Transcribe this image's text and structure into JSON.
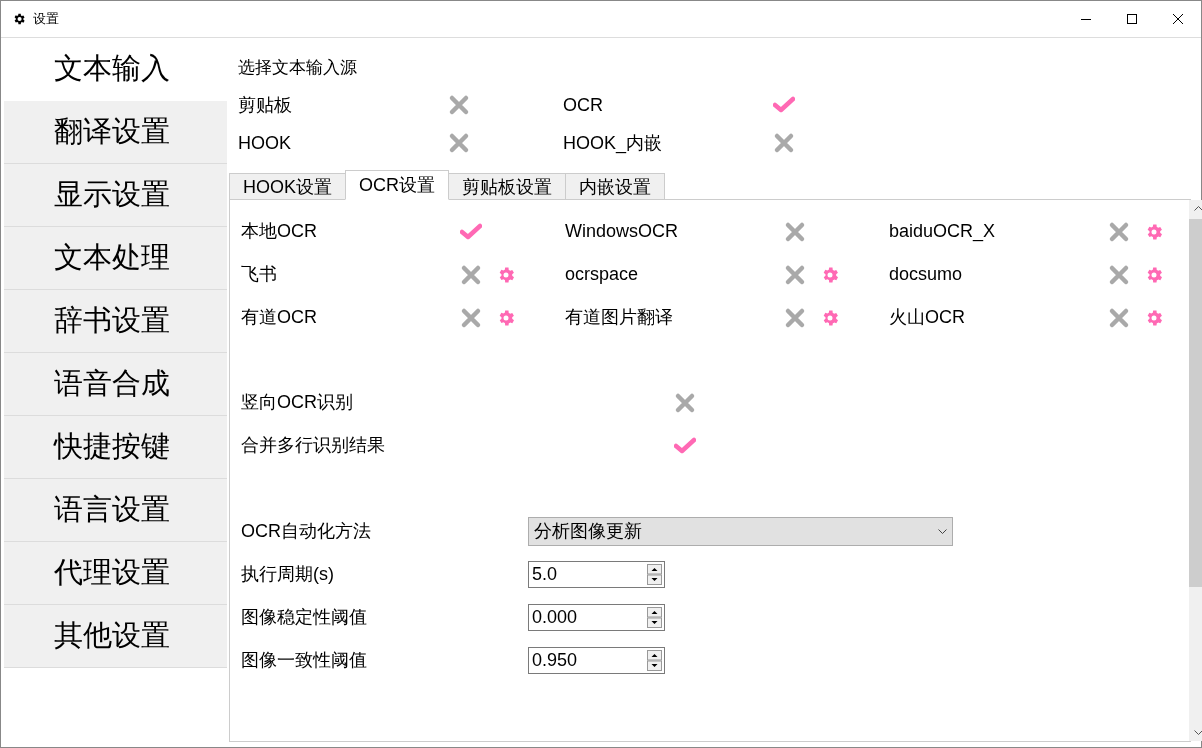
{
  "window": {
    "title": "设置"
  },
  "sidebar": {
    "items": [
      {
        "label": "文本输入",
        "selected": true
      },
      {
        "label": "翻译设置",
        "selected": false
      },
      {
        "label": "显示设置",
        "selected": false
      },
      {
        "label": "文本处理",
        "selected": false
      },
      {
        "label": "辞书设置",
        "selected": false
      },
      {
        "label": "语音合成",
        "selected": false
      },
      {
        "label": "快捷按键",
        "selected": false
      },
      {
        "label": "语言设置",
        "selected": false
      },
      {
        "label": "代理设置",
        "selected": false
      },
      {
        "label": "其他设置",
        "selected": false
      }
    ]
  },
  "input_source": {
    "title": "选择文本输入源",
    "sources": [
      {
        "label": "剪贴板",
        "checked": false
      },
      {
        "label": "OCR",
        "checked": true
      },
      {
        "label": "HOOK",
        "checked": false
      },
      {
        "label": "HOOK_内嵌",
        "checked": false
      }
    ]
  },
  "tabs": [
    {
      "label": "HOOK设置",
      "selected": false
    },
    {
      "label": "OCR设置",
      "selected": true
    },
    {
      "label": "剪贴板设置",
      "selected": false
    },
    {
      "label": "内嵌设置",
      "selected": false
    }
  ],
  "ocr_engines": [
    {
      "label": "本地OCR",
      "checked": true,
      "has_settings": false
    },
    {
      "label": "WindowsOCR",
      "checked": false,
      "has_settings": false
    },
    {
      "label": "baiduOCR_X",
      "checked": false,
      "has_settings": true
    },
    {
      "label": "飞书",
      "checked": false,
      "has_settings": true
    },
    {
      "label": "ocrspace",
      "checked": false,
      "has_settings": true
    },
    {
      "label": "docsumo",
      "checked": false,
      "has_settings": true
    },
    {
      "label": "有道OCR",
      "checked": false,
      "has_settings": true
    },
    {
      "label": "有道图片翻译",
      "checked": false,
      "has_settings": true
    },
    {
      "label": "火山OCR",
      "checked": false,
      "has_settings": true
    }
  ],
  "options": [
    {
      "label": "竖向OCR识别",
      "checked": false
    },
    {
      "label": "合并多行识别结果",
      "checked": true
    }
  ],
  "fields": [
    {
      "kind": "dropdown",
      "label": "OCR自动化方法",
      "value": "分析图像更新"
    },
    {
      "kind": "spinbox",
      "label": "执行周期(s)",
      "value": "5.0"
    },
    {
      "kind": "spinbox",
      "label": "图像稳定性阈值",
      "value": "0.000"
    },
    {
      "kind": "spinbox",
      "label": "图像一致性阈值",
      "value": "0.950"
    }
  ]
}
